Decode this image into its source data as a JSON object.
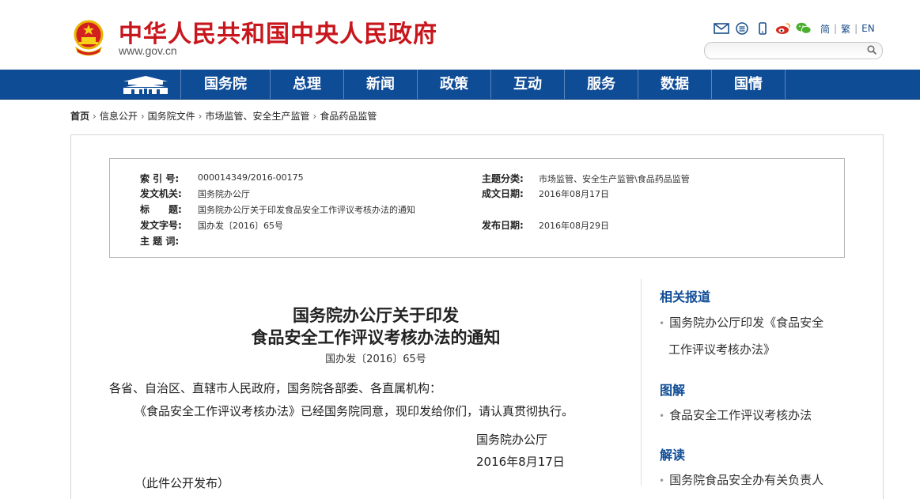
{
  "header": {
    "site_title": "中华人民共和国中央人民政府",
    "site_url": "www.gov.cn",
    "lang_simplified": "简",
    "lang_traditional": "繁",
    "lang_en": "EN",
    "search_placeholder": ""
  },
  "nav": {
    "items": [
      "国务院",
      "总理",
      "新闻",
      "政策",
      "互动",
      "服务",
      "数据",
      "国情"
    ]
  },
  "breadcrumb": {
    "items": [
      "首页",
      "信息公开",
      "国务院文件",
      "市场监管、安全生产监管",
      "食品药品监管"
    ]
  },
  "meta": {
    "index_label": "索 引 号:",
    "index_value": "000014349/2016-00175",
    "topic_label": "主题分类:",
    "topic_value": "市场监管、安全生产监管\\食品药品监管",
    "issuer_label": "发文机关:",
    "issuer_value": "国务院办公厅",
    "date_label": "成文日期:",
    "date_value": "2016年08月17日",
    "title_label": "标　　题:",
    "title_value": "国务院办公厅关于印发食品安全工作评议考核办法的通知",
    "docno_label": "发文字号:",
    "docno_value": "国办发〔2016〕65号",
    "pubdate_label": "发布日期:",
    "pubdate_value": "2016年08月29日",
    "keywords_label": "主 题 词:",
    "keywords_value": ""
  },
  "document": {
    "title_line1": "国务院办公厅关于印发",
    "title_line2": "食品安全工作评议考核办法的通知",
    "doc_number": "国办发〔2016〕65号",
    "addressee": "各省、自治区、直辖市人民政府，国务院各部委、各直属机构：",
    "body": "《食品安全工作评议考核办法》已经国务院同意，现印发给你们，请认真贯彻执行。",
    "signature": "国务院办公厅",
    "sign_date": "2016年8月17日",
    "note": "（此件公开发布）"
  },
  "sidebar": {
    "related_heading": "相关报道",
    "related_item_line1": "国务院办公厅印发《食品安全",
    "related_item_line2": "工作评议考核办法》",
    "graphic_heading": "图解",
    "graphic_item": "食品安全工作评议考核办法",
    "interpret_heading": "解读",
    "interpret_item": "国务院食品安全办有关负责人"
  }
}
